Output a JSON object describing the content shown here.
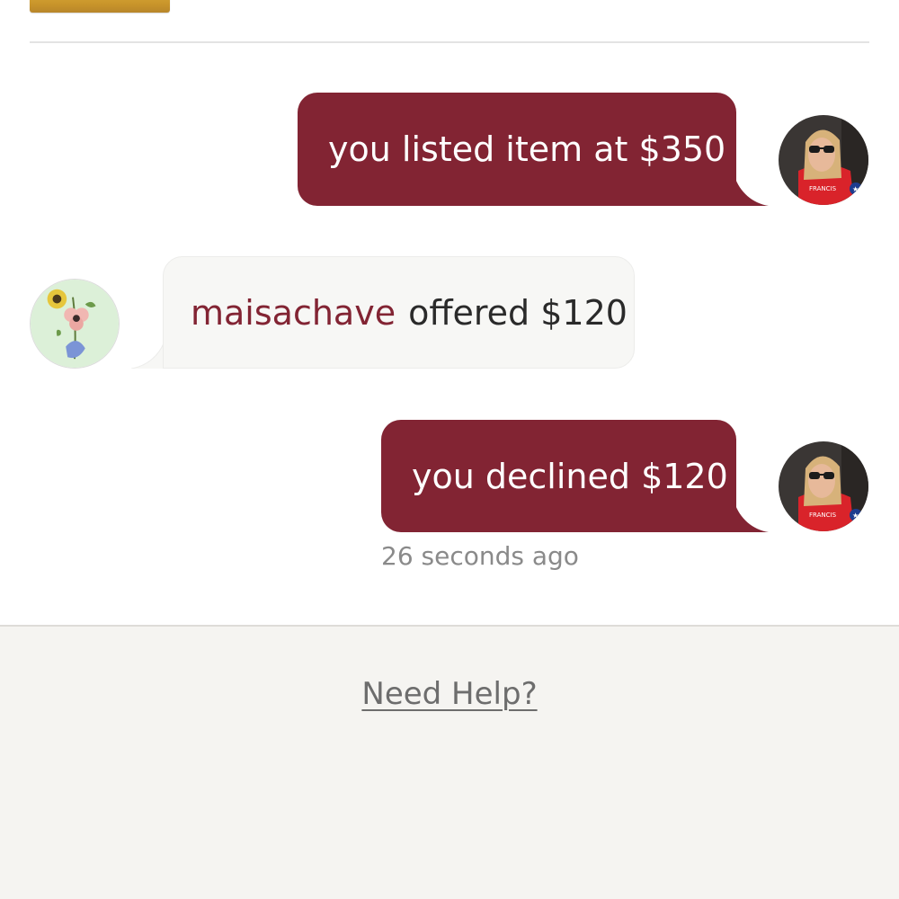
{
  "thread": {
    "messages": [
      {
        "sender": "self",
        "text": "you listed item at $350"
      },
      {
        "sender": "other",
        "username": "maisachave",
        "text": "offered $120"
      },
      {
        "sender": "self",
        "text": "you declined $120"
      }
    ],
    "last_message_time": "26 seconds ago"
  },
  "footer": {
    "help_link": "Need Help?"
  },
  "colors": {
    "outgoing_bubble": "#822433",
    "incoming_bubble": "#f7f7f5",
    "username": "#822433",
    "accent_button": "#c9952a",
    "footer_background": "#f5f4f1"
  },
  "icons": {
    "self_avatar": "user-photo-avatar",
    "other_avatar": "floral-avatar"
  }
}
